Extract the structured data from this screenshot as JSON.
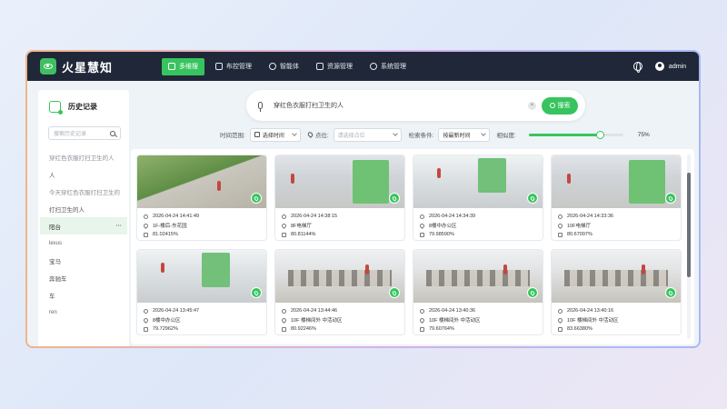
{
  "app": {
    "name": "火星慧知"
  },
  "nav": {
    "items": [
      {
        "label": "多维搜",
        "icon": "home-icon",
        "active": true
      },
      {
        "label": "布控管理",
        "icon": "clipboard-icon",
        "active": false
      },
      {
        "label": "智能体",
        "icon": "gear-icon",
        "active": false
      },
      {
        "label": "资源管理",
        "icon": "media-icon",
        "active": false
      },
      {
        "label": "系统管理",
        "icon": "settings-icon",
        "active": false
      }
    ],
    "user": "admin"
  },
  "sidebar": {
    "title": "历史记录",
    "search_placeholder": "搜索历史记录",
    "items": [
      {
        "label": "穿红色衣服打扫卫生的人"
      },
      {
        "label": "人"
      },
      {
        "label": "今天穿红色衣服打扫卫生的人"
      },
      {
        "label": "打扫卫生的人"
      },
      {
        "label": "阳台",
        "active": true,
        "more": "···"
      },
      {
        "label": "lexus"
      },
      {
        "label": "宝马"
      },
      {
        "label": "奔驰车"
      },
      {
        "label": "车"
      },
      {
        "label": "ren"
      }
    ]
  },
  "search": {
    "query": "穿红色衣服打扫卫生的人",
    "button_label": "搜索",
    "clear": "×"
  },
  "filters": {
    "time_label": "时间范围:",
    "time_value": "选择时间",
    "location_label": "点位:",
    "location_placeholder": "请选择点位",
    "sort_label": "检索条件:",
    "sort_value": "按最新时间",
    "similarity_label": "相似度:",
    "similarity_value": "75%",
    "similarity_fraction": 0.75
  },
  "results": [
    {
      "time": "2026-04-24 14:41:49",
      "location": "1F-楼后-东花园",
      "score": "81.02415%",
      "scene": "a"
    },
    {
      "time": "2026-04-24 14:38:15",
      "location": "8F电梯厅",
      "score": "80.81144%",
      "scene": "b"
    },
    {
      "time": "2026-04-24 14:34:39",
      "location": "8楼中办公区",
      "score": "79.98590%",
      "scene": "c"
    },
    {
      "time": "2026-04-24 14:33:36",
      "location": "10F电梯厅",
      "score": "80.67097%",
      "scene": "b"
    },
    {
      "time": "2026-04-24 13:45:47",
      "location": "8楼中办公区",
      "score": "79.72962%",
      "scene": "c"
    },
    {
      "time": "2026-04-24 13:44:46",
      "location": "10F 楼梯间外 中活动区",
      "score": "80.92246%",
      "scene": "d"
    },
    {
      "time": "2026-04-24 13:40:36",
      "location": "10F 楼梯间外 中活动区",
      "score": "79.60764%",
      "scene": "d"
    },
    {
      "time": "2026-04-24 13:40:16",
      "location": "10F 楼梯间外 中活动区",
      "score": "83.66380%",
      "scene": "d"
    }
  ],
  "colors": {
    "accent": "#37c45e",
    "nav_bg": "#1f2738"
  }
}
